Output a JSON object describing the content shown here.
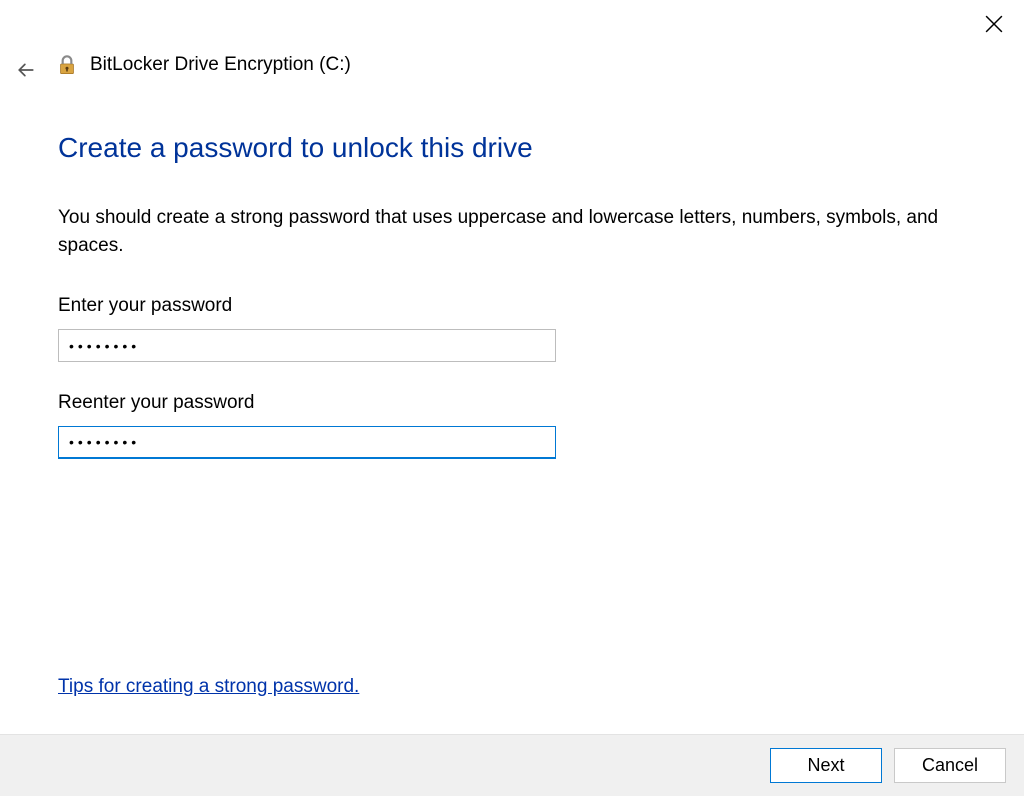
{
  "window": {
    "title": "BitLocker Drive Encryption (C:)"
  },
  "page": {
    "heading": "Create a password to unlock this drive",
    "instruction": "You should create a strong password that uses uppercase and lowercase letters, numbers, symbols, and spaces."
  },
  "fields": {
    "enter_label": "Enter your password",
    "enter_value": "••••••••",
    "reenter_label": "Reenter your password",
    "reenter_value": "••••••••"
  },
  "link": {
    "tips_label": "Tips for creating a strong password."
  },
  "footer": {
    "next_label": "Next",
    "cancel_label": "Cancel"
  }
}
